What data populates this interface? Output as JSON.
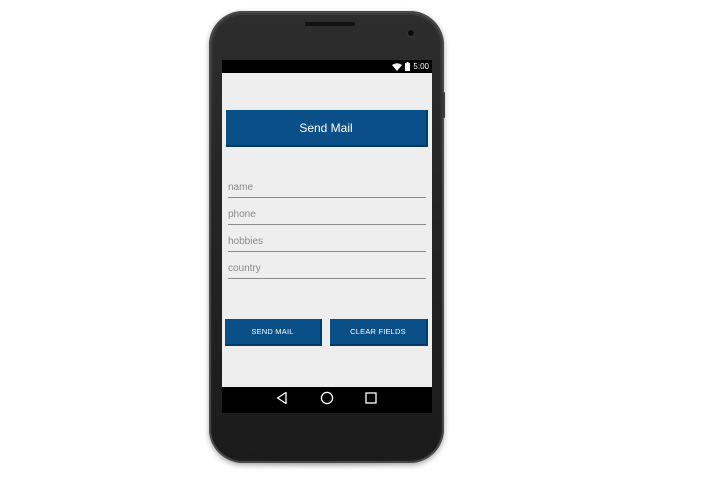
{
  "status_bar": {
    "time": "5:00",
    "wifi_icon": "wifi-icon",
    "battery_icon": "battery-icon"
  },
  "app": {
    "title_button_label": "Send Mail"
  },
  "form": {
    "fields": [
      {
        "placeholder": "name",
        "value": ""
      },
      {
        "placeholder": "phone",
        "value": ""
      },
      {
        "placeholder": "hobbies",
        "value": ""
      },
      {
        "placeholder": "country",
        "value": ""
      }
    ]
  },
  "actions": {
    "send_mail_label": "SEND MAIL",
    "clear_fields_label": "CLEAR FIELDS"
  },
  "nav_bar": {
    "back_icon": "back-icon",
    "home_icon": "home-icon",
    "recents_icon": "recents-icon"
  },
  "colors": {
    "accent": "#0b4f89",
    "screen_background": "#eeeeee",
    "status_bar": "#000000"
  }
}
